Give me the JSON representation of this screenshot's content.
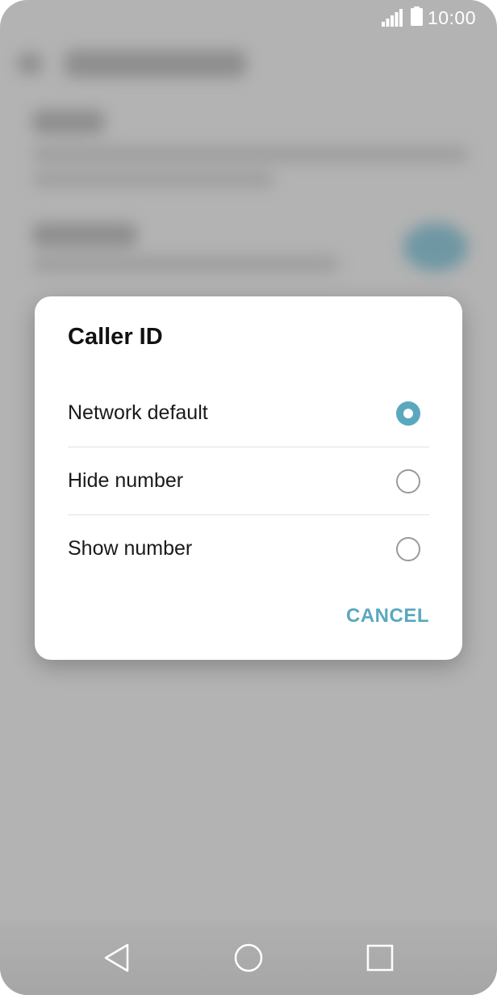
{
  "status_bar": {
    "time": "10:00",
    "signal_icon": "signal-icon",
    "battery_icon": "battery-icon"
  },
  "dialog": {
    "title": "Caller ID",
    "options": [
      {
        "label": "Network default",
        "selected": true
      },
      {
        "label": "Hide number",
        "selected": false
      },
      {
        "label": "Show number",
        "selected": false
      }
    ],
    "cancel_label": "CANCEL"
  },
  "nav_bar": {
    "back_icon": "back-icon",
    "home_icon": "home-icon",
    "recents_icon": "recents-icon"
  },
  "colors": {
    "accent": "#5aa8bf",
    "scrim": "#b3b3b3"
  }
}
